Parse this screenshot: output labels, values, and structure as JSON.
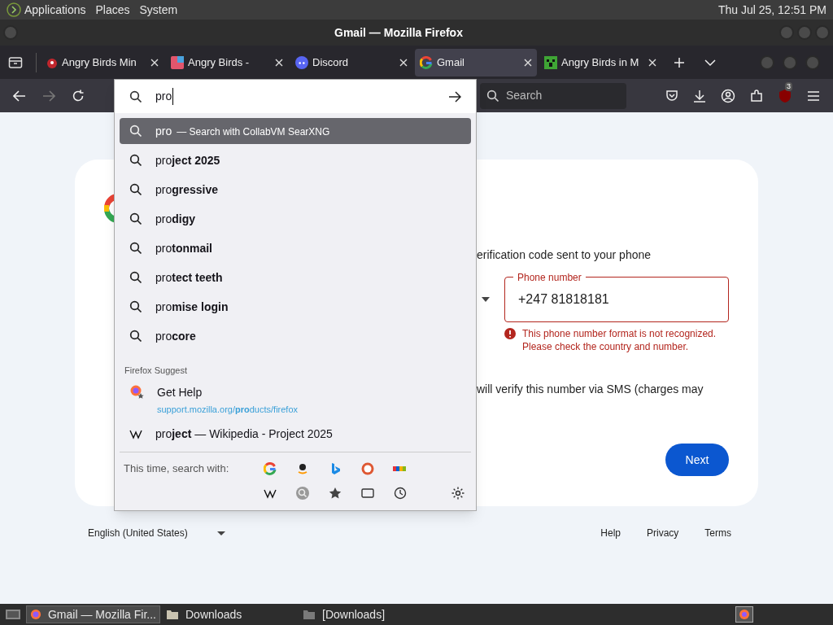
{
  "top_panel": {
    "menus": [
      "Applications",
      "Places",
      "System"
    ],
    "clock": "Thu Jul 25, 12:51 PM"
  },
  "window": {
    "title": "Gmail — Mozilla Firefox"
  },
  "tabs": [
    {
      "title": "Angry Birds Min",
      "selected": false
    },
    {
      "title": "Angry Birds -",
      "selected": false
    },
    {
      "title": "Discord",
      "selected": false
    },
    {
      "title": "Gmail",
      "selected": true
    },
    {
      "title": "Angry Birds in M",
      "selected": false
    }
  ],
  "toolbar": {
    "search_placeholder": "Search",
    "extension_badge": "3"
  },
  "urlbar": {
    "value": "pro"
  },
  "dropdown": {
    "suggestions": [
      {
        "text": "pro",
        "hint": "— Search with CollabVM SearXNG",
        "selected": true
      },
      {
        "text": "pro**ject 2025**",
        "selected": false
      },
      {
        "text": "pro**gressive**",
        "selected": false
      },
      {
        "text": "pro**digy**",
        "selected": false
      },
      {
        "text": "pro**tonmail**",
        "selected": false
      },
      {
        "text": "pro**tect teeth**",
        "selected": false
      },
      {
        "text": "pro**mise login**",
        "selected": false
      },
      {
        "text": "pro**core**",
        "selected": false
      }
    ],
    "section_label": "Firefox Suggest",
    "suggest": {
      "title": "Get Help",
      "url": "support.mozilla.org/**pro**ducts/firefox"
    },
    "wiki": "pro**ject** — Wikipedia - Project 2025",
    "search_with_label": "This time, search with:"
  },
  "page": {
    "prompt": "erification code sent to your phone",
    "phone_label": "Phone number",
    "phone_value": "+247 81818181",
    "error": "This phone number format is not recognized. Please check the country and number.",
    "sms_note": "will verify this number via SMS (charges may",
    "next": "Next"
  },
  "footer": {
    "language": "English (United States)",
    "links": [
      "Help",
      "Privacy",
      "Terms"
    ]
  },
  "taskbar": {
    "items": [
      {
        "label": "Gmail — Mozilla Fir...",
        "selected": true
      },
      {
        "label": "Downloads",
        "selected": false
      },
      {
        "label": "[Downloads]",
        "selected": false
      }
    ]
  }
}
